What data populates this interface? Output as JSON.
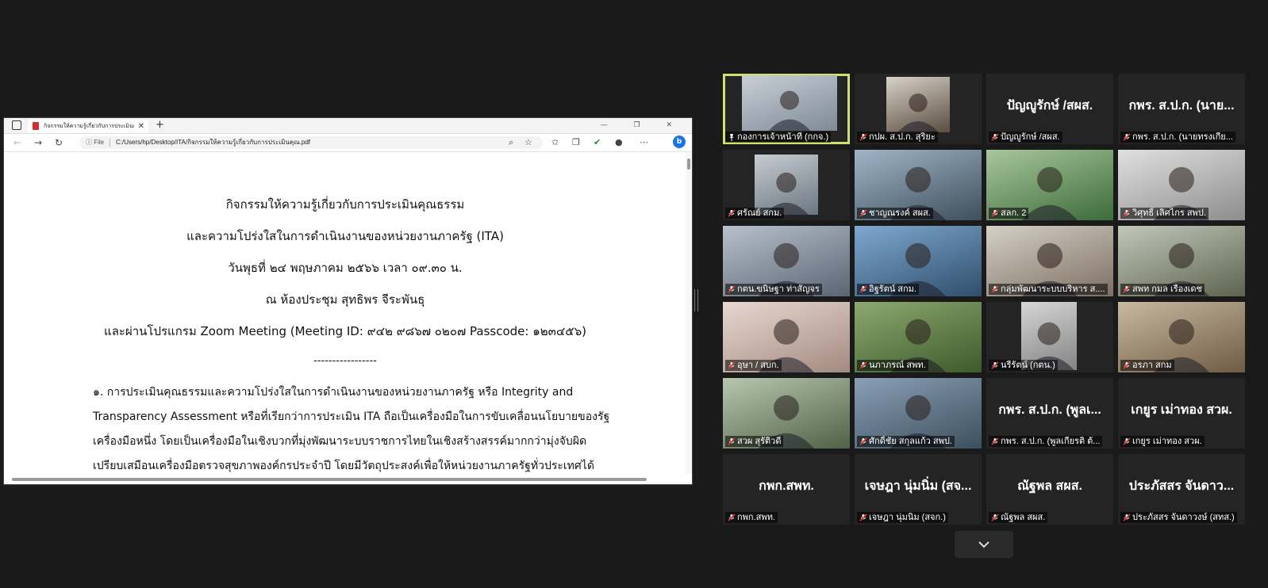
{
  "browser": {
    "tab_title": "กิจกรรมให้ความรู้เกี่ยวกับการประเมินคุณธรรม",
    "new_tab": "+",
    "window_controls": "— ❐ ✕",
    "url_prefix": "File",
    "url": "C:/Users/hp/Desktop/ITA/กิจกรรมให้ความรู้เกี่ยวกับการประเมินคุณ.pdf"
  },
  "document": {
    "lines": [
      "กิจกรรมให้ความรู้เกี่ยวกับการประเมินคุณธรรม",
      "และความโปร่งใสในการดำเนินงานของหน่วยงานภาครัฐ (ITA)",
      "วันพุธที่ ๒๔ พฤษภาคม ๒๕๖๖ เวลา ๐๙.๓๐ น.",
      "ณ ห้องประชุม สุทธิพร จีระพันธุ",
      "และผ่านโปรแกรม Zoom Meeting (Meeting ID: ๙๔๒ ๙๘๖๗ ๐๒๐๗ Passcode: ๑๒๓๔๕๖)",
      "-----------------"
    ],
    "paragraph": [
      "         ๑. การประเมินคุณธรรมและความโปร่งใสในการดำเนินงานของหน่วยงานภาครัฐ หรือ Integrity and",
      "Transparency Assessment หรือที่เรียกว่าการประเมิน ITA ถือเป็นเครื่องมือในการขับเคลื่อนนโยบายของรัฐ",
      "เครื่องมือหนึ่ง โดยเป็นเครื่องมือในเชิงบวกที่มุ่งพัฒนาระบบราชการไทยในเชิงสร้างสรรค์มากกว่ามุ่งจับผิด",
      "เปรียบเสมือนเครื่องมือตรวจสุขภาพองค์กรประจำปี โดยมีวัตถุประสงค์เพื่อให้หน่วยงานภาครัฐทั่วประเทศได้"
    ]
  },
  "participants": [
    {
      "label": "กองการเจ้าหน้าที่ (กกจ.)",
      "big": "",
      "video": true
    },
    {
      "label": "กปผ. ส.ป.ก. สุริยะ",
      "big": "",
      "video": true
    },
    {
      "label": "ปัญญูรักษ์ /สผส.",
      "big": "ปัญญูรักษ์ /สผส.",
      "video": false
    },
    {
      "label": "กพร. ส.ป.ก. (นายทรงเกีย...",
      "big": "กพร. ส.ป.ก. (นาย...",
      "video": false
    },
    {
      "label": "ศรัณย์ สกม.",
      "big": "",
      "video": true
    },
    {
      "label": "ชาญณรงค์ สผส.",
      "big": "",
      "video": true
    },
    {
      "label": "สลก. 2",
      "big": "",
      "video": true
    },
    {
      "label": "วิศุทธิ์ เลิศไกร สพป.",
      "big": "",
      "video": true
    },
    {
      "label": "กตน.ขนิษฐา ท่าสัญจร",
      "big": "",
      "video": true
    },
    {
      "label": "อิฐรัตน์ สกม.",
      "big": "",
      "video": true
    },
    {
      "label": "กลุ่มพัฒนาระบบบริหาร ส....",
      "big": "",
      "video": true
    },
    {
      "label": "สพท กมล เรืองเดช",
      "big": "",
      "video": true
    },
    {
      "label": "อุษา / สบก.",
      "big": "",
      "video": true
    },
    {
      "label": "นภาภรณ์ สพท.",
      "big": "",
      "video": true
    },
    {
      "label": "นรีรัตน์ (กตน.)",
      "big": "",
      "video": true
    },
    {
      "label": "อรภา สกม",
      "big": "",
      "video": true
    },
    {
      "label": "สวผ สุรัติวดี",
      "big": "",
      "video": true
    },
    {
      "label": "ศักดิ์ชัย สกุลแก้ว สพป.",
      "big": "",
      "video": true
    },
    {
      "label": "กพร. ส.ป.ก. (พูลเกียรติ ต้...",
      "big": "กพร. ส.ป.ก. (พูลเ...",
      "video": false
    },
    {
      "label": "เกยูร เม่าทอง สวผ.",
      "big": "เกยูร เม่าทอง สวผ.",
      "video": false
    },
    {
      "label": "กพก.สพท.",
      "big": "กพก.สพท.",
      "video": false
    },
    {
      "label": "เจษฎา นุ่มนิ่ม (สจก.)",
      "big": "เจษฎา นุ่มนิ่ม (สจ...",
      "video": false
    },
    {
      "label": "ณัฐพล สผส.",
      "big": "ณัฐพล สผส.",
      "video": false
    },
    {
      "label": "ประภัสสร จันดาวงษ์ (สทส.)",
      "big": "ประภัสสร จันดาว...",
      "video": false
    }
  ],
  "colors": {
    "background": "#1a1a1a",
    "active_speaker": "#cbe36b",
    "muted_mic": "#e53935"
  },
  "icons": {
    "mic_muted": "mic-off-icon",
    "pin": "pin-icon",
    "chevron": "chevron-down-icon"
  }
}
